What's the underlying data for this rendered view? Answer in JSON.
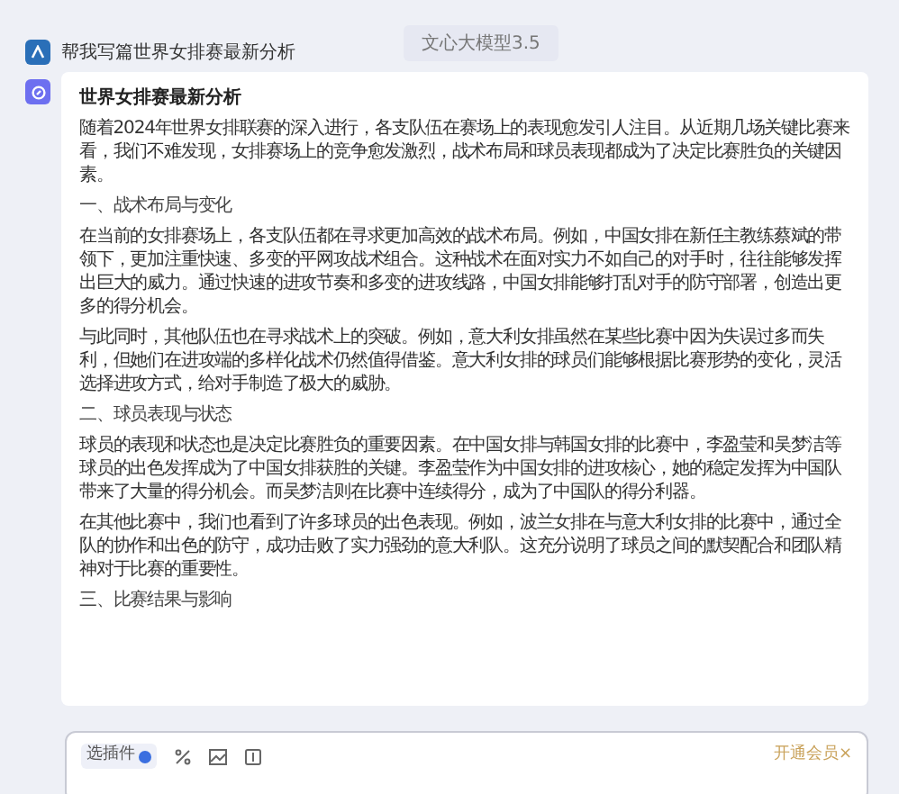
{
  "model_badge": "文心大模型3.5",
  "user_prompt": "帮我写篇世界女排赛最新分析",
  "answer": {
    "title": "世界女排赛最新分析",
    "blocks": [
      {
        "kind": "paragraph",
        "text": "随着2024年世界女排联赛的深入进行，各支队伍在赛场上的表现愈发引人注目。从近期几场关键比赛来看，我们不难发现，女排赛场上的竞争愈发激烈，战术布局和球员表现都成为了决定比赛胜负的关键因素。"
      },
      {
        "kind": "heading",
        "text": "一、战术布局与变化"
      },
      {
        "kind": "paragraph",
        "text": "在当前的女排赛场上，各支队伍都在寻求更加高效的战术布局。例如，中国女排在新任主教练蔡斌的带领下，更加注重快速、多变的平网攻战术组合。这种战术在面对实力不如自己的对手时，往往能够发挥出巨大的威力。通过快速的进攻节奏和多变的进攻线路，中国女排能够打乱对手的防守部署，创造出更多的得分机会。"
      },
      {
        "kind": "paragraph",
        "text": "与此同时，其他队伍也在寻求战术上的突破。例如，意大利女排虽然在某些比赛中因为失误过多而失利，但她们在进攻端的多样化战术仍然值得借鉴。意大利女排的球员们能够根据比赛形势的变化，灵活选择进攻方式，给对手制造了极大的威胁。"
      },
      {
        "kind": "heading",
        "text": "二、球员表现与状态"
      },
      {
        "kind": "paragraph",
        "text": "球员的表现和状态也是决定比赛胜负的重要因素。在中国女排与韩国女排的比赛中，李盈莹和吴梦洁等球员的出色发挥成为了中国女排获胜的关键。李盈莹作为中国女排的进攻核心，她的稳定发挥为中国队带来了大量的得分机会。而吴梦洁则在比赛中连续得分，成为了中国队的得分利器。"
      },
      {
        "kind": "paragraph",
        "text": "在其他比赛中，我们也看到了许多球员的出色表现。例如，波兰女排在与意大利女排的比赛中，通过全队的协作和出色的防守，成功击败了实力强劲的意大利队。这充分说明了球员之间的默契配合和团队精神对于比赛的重要性。"
      },
      {
        "kind": "heading",
        "text": "三、比赛结果与影响"
      }
    ]
  },
  "composer": {
    "plugin_button": "选插件",
    "membership_link": "开通会员×"
  }
}
